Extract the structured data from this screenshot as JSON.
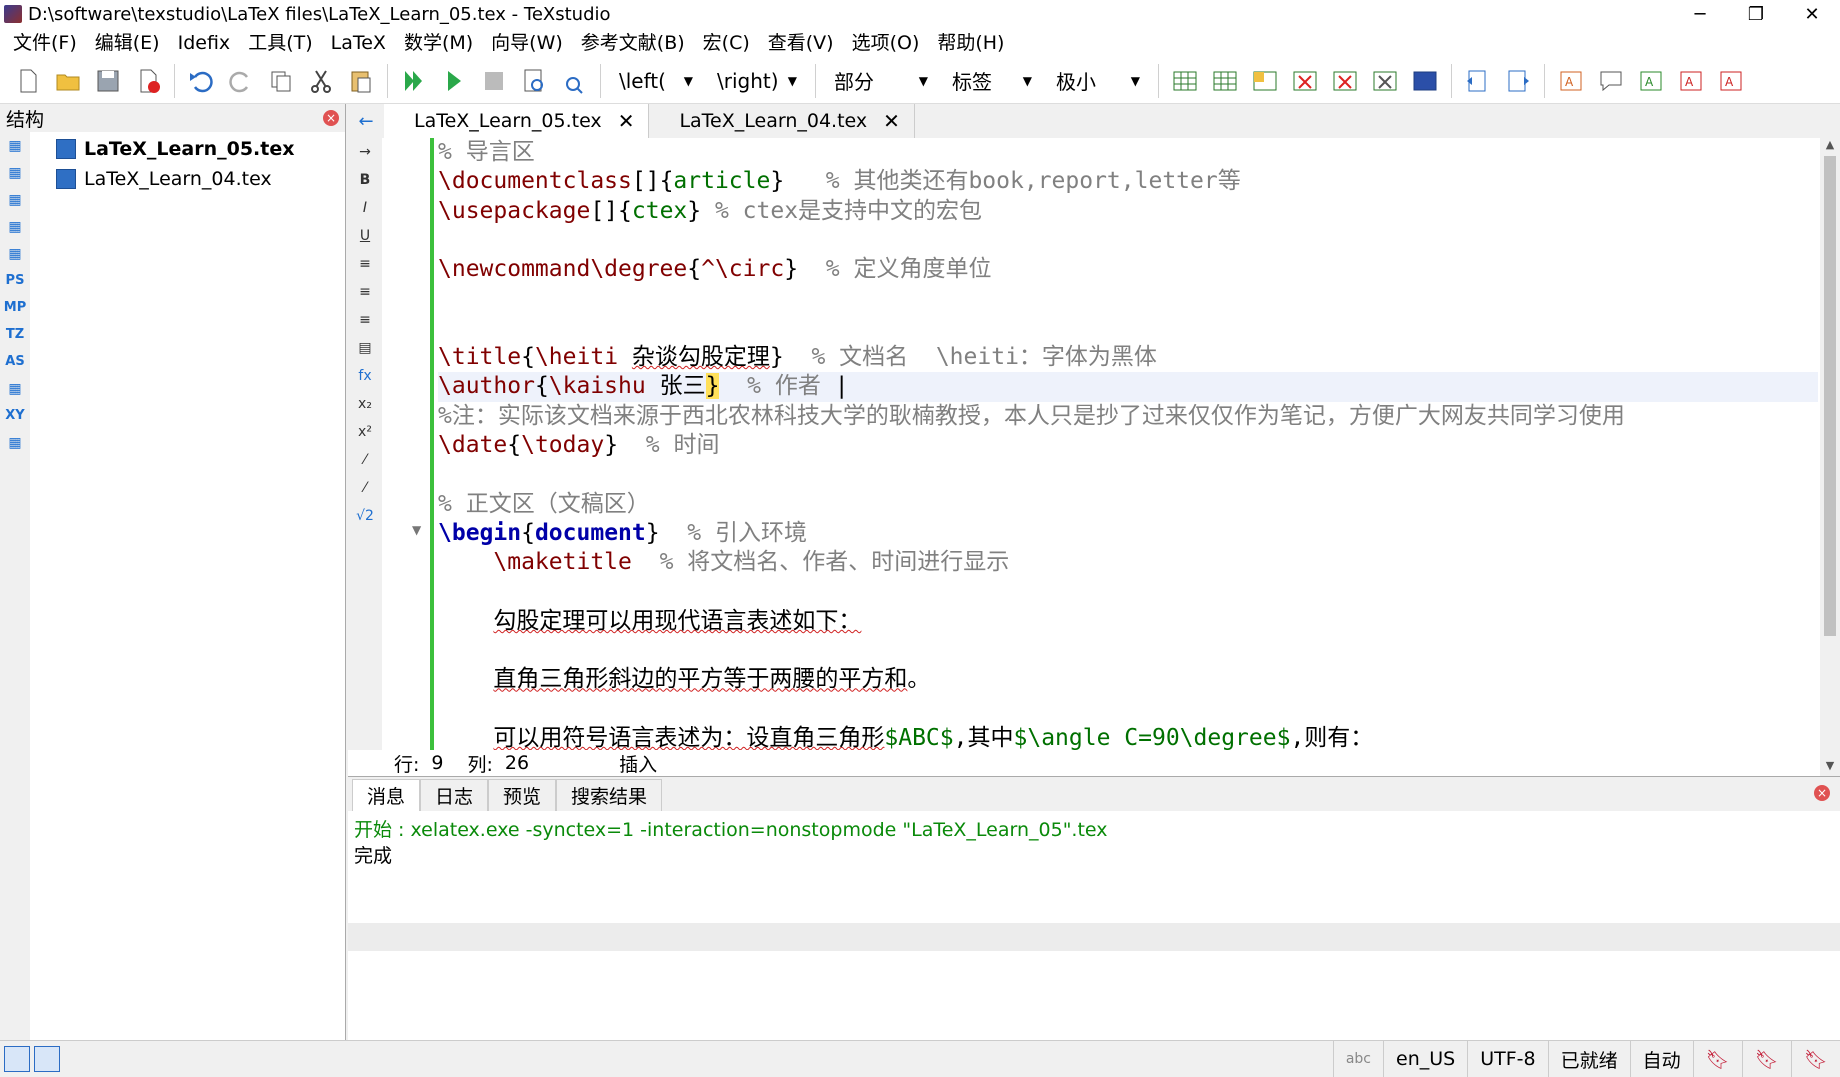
{
  "window": {
    "title": "D:\\software\\texstudio\\LaTeX files\\LaTeX_Learn_05.tex - TeXstudio",
    "minimize": "─",
    "restore": "❐",
    "close": "✕"
  },
  "menubar": [
    "文件(F)",
    "编辑(E)",
    "Idefix",
    "工具(T)",
    "LaTeX",
    "数学(M)",
    "向导(W)",
    "参考文献(B)",
    "宏(C)",
    "查看(V)",
    "选项(O)",
    "帮助(H)"
  ],
  "toolbar": {
    "combos": [
      "\\left(",
      "\\right)",
      "部分",
      "标签",
      "极小"
    ]
  },
  "structure": {
    "title": "结构",
    "files": [
      "LaTeX_Learn_05.tex",
      "LaTeX_Learn_04.tex"
    ],
    "side_tools": [
      "",
      "",
      "",
      "",
      "",
      "PS",
      "MP",
      "TZ",
      "AS",
      "",
      "XY",
      ""
    ]
  },
  "tabs": [
    {
      "label": "LaTeX_Learn_05.tex",
      "active": true
    },
    {
      "label": "LaTeX_Learn_04.tex",
      "active": false
    }
  ],
  "edit_tools": [
    "→",
    "B",
    "I",
    "U",
    "≡",
    "≡",
    "≡",
    "▤",
    "fx",
    "x₂",
    "x²",
    "⁄",
    "⁄",
    "√2"
  ],
  "editor": {
    "lines": [
      [
        [
          "cmt",
          "% 导言区"
        ]
      ],
      [
        [
          "cmd",
          "\\documentclass"
        ],
        [
          "brace",
          "[]{"
        ],
        [
          "arg",
          "article"
        ],
        [
          "brace",
          "}"
        ],
        [
          "cmt",
          "   % 其他类还有book,report,letter等"
        ]
      ],
      [
        [
          "cmd",
          "\\usepackage"
        ],
        [
          "brace",
          "[]{"
        ],
        [
          "arg",
          "ctex"
        ],
        [
          "brace",
          "}"
        ],
        [
          "cmt",
          " % ctex是支持中文的宏包"
        ]
      ],
      [],
      [
        [
          "cmd",
          "\\newcommand\\degree"
        ],
        [
          "brace",
          "{"
        ],
        [
          "cmd",
          "^\\circ"
        ],
        [
          "brace",
          "}"
        ],
        [
          "cmt",
          "  % 定义角度单位"
        ]
      ],
      [],
      [],
      [
        [
          "cmd",
          "\\title"
        ],
        [
          "brace",
          "{"
        ],
        [
          "cmd",
          "\\heiti "
        ],
        [
          "uline",
          "杂谈勾股定理"
        ],
        [
          "brace",
          "}"
        ],
        [
          "cmt",
          "  % 文档名  \\heiti：字体为黑体"
        ]
      ],
      [
        [
          "cmd",
          "\\author"
        ],
        [
          "brace",
          "{"
        ],
        [
          "cmd",
          "\\kaishu "
        ],
        [
          "brace",
          "张三"
        ],
        [
          "hl",
          "}"
        ],
        [
          "cmt",
          "  % 作者 "
        ]
      ],
      [
        [
          "cmt",
          "%注：实际该文档来源于西北农林科技大学的耿楠教授，本人只是抄了过来仅仅作为笔记，方便广大网友共同学习使用"
        ]
      ],
      [
        [
          "cmd",
          "\\date"
        ],
        [
          "brace",
          "{"
        ],
        [
          "cmd",
          "\\today"
        ],
        [
          "brace",
          "}"
        ],
        [
          "cmt",
          "  % 时间"
        ]
      ],
      [],
      [
        [
          "cmt",
          "% 正文区（文稿区）"
        ]
      ],
      [
        [
          "kw",
          "\\begin"
        ],
        [
          "brace",
          "{"
        ],
        [
          "kw",
          "document"
        ],
        [
          "brace",
          "}"
        ],
        [
          "cmt",
          "  % 引入环境"
        ]
      ],
      [
        [
          "brace",
          "    "
        ],
        [
          "cmd",
          "\\maketitle"
        ],
        [
          "cmt",
          "  % 将文档名、作者、时间进行显示"
        ]
      ],
      [],
      [
        [
          "brace",
          "    "
        ],
        [
          "uline",
          "勾股定理可以用现代语言表述如下："
        ]
      ],
      [],
      [
        [
          "brace",
          "    "
        ],
        [
          "uline",
          "直角三角形斜边的平方等于两腰的平方和"
        ],
        [
          "brace",
          "。"
        ]
      ],
      [],
      [
        [
          "brace",
          "    "
        ],
        [
          "uline",
          "可以用符号语言表述为：设直角三角形"
        ],
        [
          "math",
          "$ABC$"
        ],
        [
          "brace",
          ",其中"
        ],
        [
          "math",
          "$\\angle C=90\\degree$"
        ],
        [
          "brace",
          ",则有："
        ]
      ]
    ],
    "current_line": 8
  },
  "cursor_status": {
    "row_label": "行:",
    "row": "9",
    "col_label": "列:",
    "col": "26",
    "mode": "插入"
  },
  "bottom": {
    "tabs": [
      "消息",
      "日志",
      "预览",
      "搜索结果"
    ],
    "messages": [
      "开始 : xelatex.exe -synctex=1 -interaction=nonstopmode \"LaTeX_Learn_05\".tex",
      "",
      "完成"
    ]
  },
  "statusbar": {
    "lang": "en_US",
    "encoding": "UTF-8",
    "state": "已就绪",
    "auto": "自动"
  },
  "colors": {
    "accent": "#1e6fd0",
    "green_bar": "#3cc03c",
    "comment": "#808080",
    "command": "#800000"
  }
}
